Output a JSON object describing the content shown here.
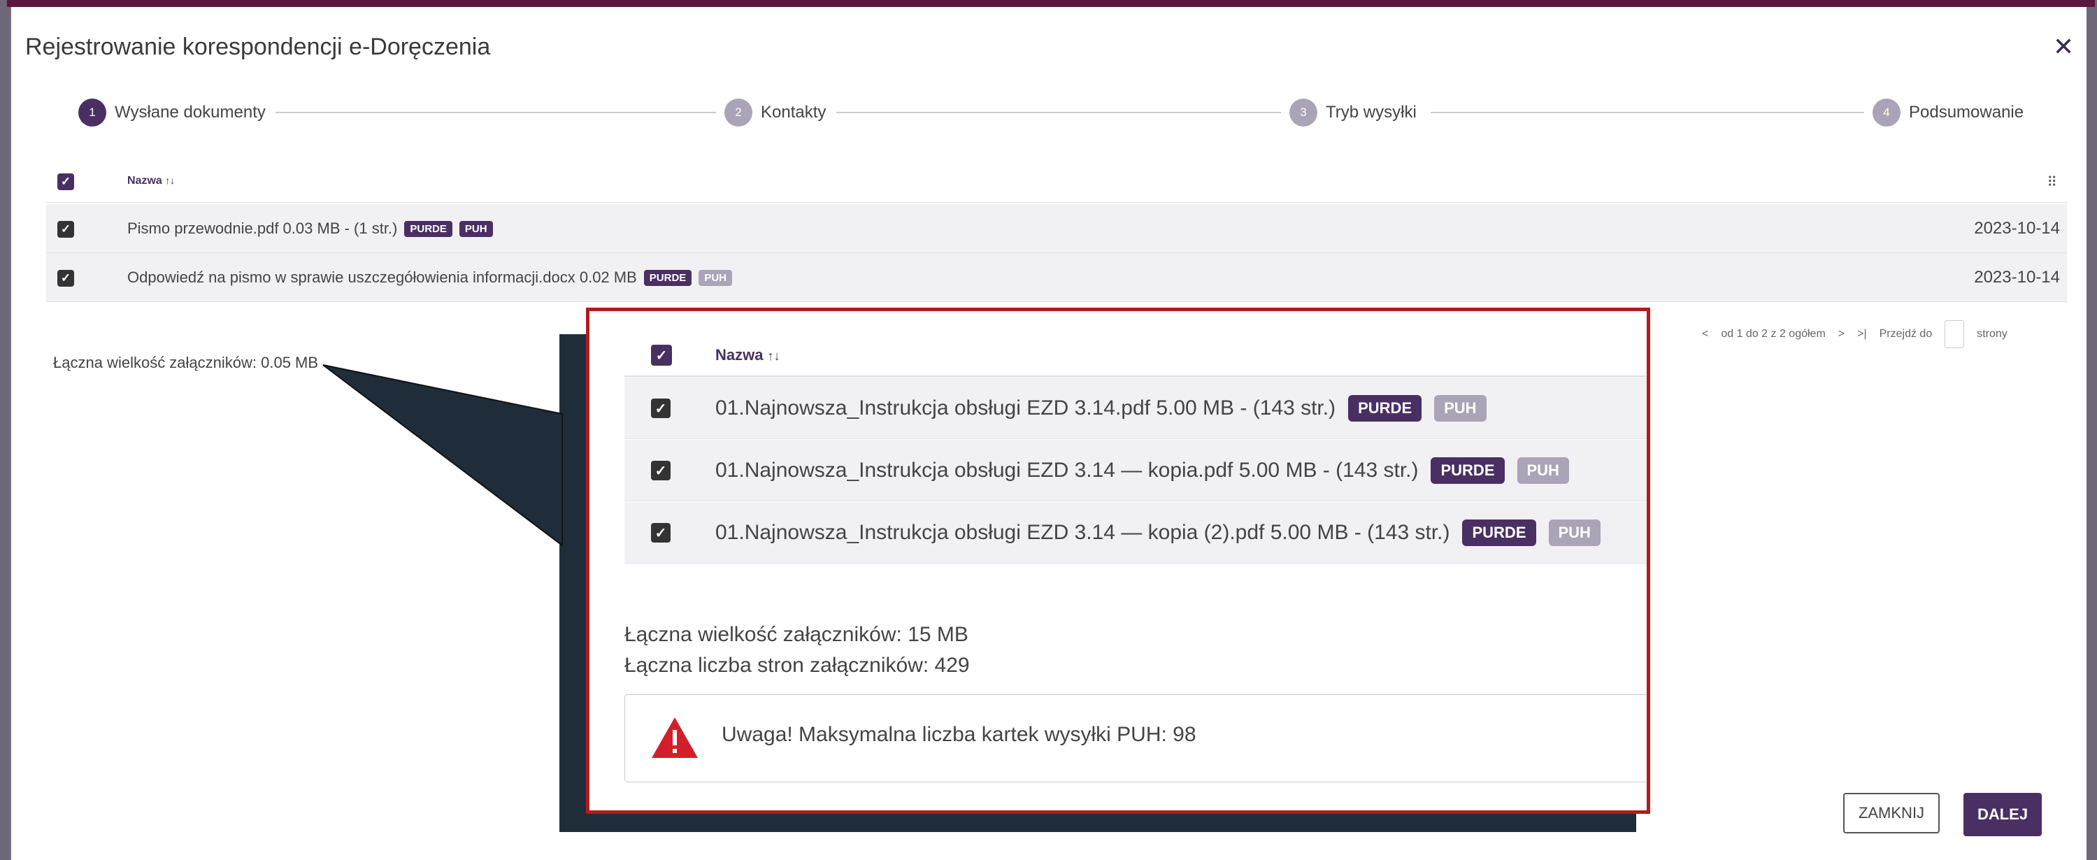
{
  "dialog": {
    "title": "Rejestrowanie korespondencji e-Doręczenia",
    "close_icon": "close-icon"
  },
  "steps": [
    {
      "number": "1",
      "label": "Wysłane dokumenty",
      "active": true
    },
    {
      "number": "2",
      "label": "Kontakty",
      "active": false
    },
    {
      "number": "3",
      "label": "Tryb wysyłki",
      "active": false
    },
    {
      "number": "4",
      "label": "Podsumowanie",
      "active": false
    }
  ],
  "table": {
    "header": {
      "name": "Nazwa",
      "sort_icon": "↑↓",
      "columns_icon": "⠿"
    },
    "rows": [
      {
        "name": "Pismo przewodnie.pdf 0.03 MB - (1 str.)",
        "badge1": "PURDE",
        "badge2": "PUH",
        "date": "2023-10-14"
      },
      {
        "name": "Odpowiedź na pismo w sprawie uszczegółowienia informacji.docx 0.02 MB",
        "badge1": "PURDE",
        "badge2": "PUH",
        "date": "2023-10-14"
      }
    ]
  },
  "summary": {
    "total_size": "Łączna wielkość załączników: 0.05 MB"
  },
  "pager": {
    "prev": "<",
    "range": "od 1 do 2 z 2 ogółem",
    "next": ">",
    "last": ">|",
    "go_to": "Przejdź do",
    "page_suffix": "strony"
  },
  "buttons": {
    "close": "ZAMKNIJ",
    "next": "DALEJ"
  },
  "zoom": {
    "header": {
      "name": "Nazwa",
      "sort_icon": "↑↓"
    },
    "rows": [
      {
        "name": "01.Najnowsza_Instrukcja obsługi EZD 3.14.pdf 5.00 MB - (143 str.)",
        "badge1": "PURDE",
        "badge2": "PUH"
      },
      {
        "name": "01.Najnowsza_Instrukcja obsługi EZD 3.14 — kopia.pdf 5.00 MB - (143 str.)",
        "badge1": "PURDE",
        "badge2": "PUH"
      },
      {
        "name": "01.Najnowsza_Instrukcja obsługi EZD 3.14 — kopia (2).pdf 5.00 MB - (143 str.)",
        "badge1": "PURDE",
        "badge2": "PUH"
      }
    ],
    "total_size": "Łączna wielkość załączników: 15 MB",
    "total_pages": "Łączna liczba stron załączników: 429",
    "warning": "Uwaga! Maksymalna liczba kartek wysyłki PUH: 98"
  },
  "colors": {
    "accent": "#4a2f63",
    "badge_light": "#aaa4b6",
    "callout_border": "#b41b1b",
    "warning_red": "#d41f2a"
  }
}
